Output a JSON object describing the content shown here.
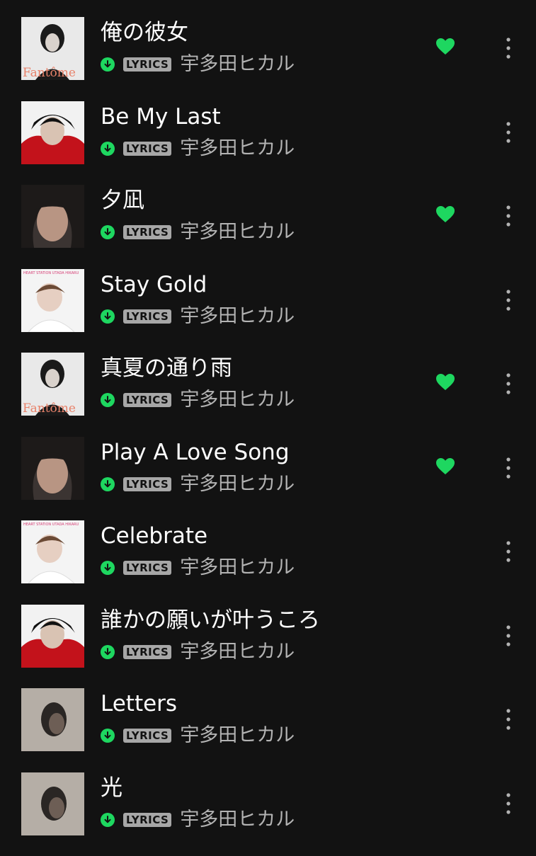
{
  "tracks": [
    {
      "title": "俺の彼女",
      "artist": "宇多田ヒカル",
      "badge": "LYRICS",
      "downloaded": true,
      "liked": true,
      "cover_icon": "album-cover-fantome",
      "cover_text": "Fantôme"
    },
    {
      "title": "Be My Last",
      "artist": "宇多田ヒカル",
      "badge": "LYRICS",
      "downloaded": true,
      "liked": false,
      "cover_icon": "album-cover-red-hood"
    },
    {
      "title": "夕凪",
      "artist": "宇多田ヒカル",
      "badge": "LYRICS",
      "downloaded": true,
      "liked": true,
      "cover_icon": "album-cover-portrait"
    },
    {
      "title": "Stay Gold",
      "artist": "宇多田ヒカル",
      "badge": "LYRICS",
      "downloaded": true,
      "liked": false,
      "cover_icon": "album-cover-heart-station",
      "cover_text": "HEART STATION  UTADA HIKARU"
    },
    {
      "title": "真夏の通り雨",
      "artist": "宇多田ヒカル",
      "badge": "LYRICS",
      "downloaded": true,
      "liked": true,
      "cover_icon": "album-cover-fantome",
      "cover_text": "Fantôme"
    },
    {
      "title": "Play A Love Song",
      "artist": "宇多田ヒカル",
      "badge": "LYRICS",
      "downloaded": true,
      "liked": true,
      "cover_icon": "album-cover-portrait"
    },
    {
      "title": "Celebrate",
      "artist": "宇多田ヒカル",
      "badge": "LYRICS",
      "downloaded": true,
      "liked": false,
      "cover_icon": "album-cover-heart-station",
      "cover_text": "HEART STATION  UTADA HIKARU"
    },
    {
      "title": "誰かの願いが叶うころ",
      "artist": "宇多田ヒカル",
      "badge": "LYRICS",
      "downloaded": true,
      "liked": false,
      "cover_icon": "album-cover-red-hood"
    },
    {
      "title": "Letters",
      "artist": "宇多田ヒカル",
      "badge": "LYRICS",
      "downloaded": true,
      "liked": false,
      "cover_icon": "album-cover-sepia"
    },
    {
      "title": "光",
      "artist": "宇多田ヒカル",
      "badge": "LYRICS",
      "downloaded": true,
      "liked": false,
      "cover_icon": "album-cover-sepia"
    }
  ],
  "colors": {
    "background": "#121212",
    "accent_green": "#1ed760",
    "secondary_text": "#b3b3b3",
    "badge_bg": "#a7a7a7"
  },
  "icons": {
    "download": "download-arrow-icon",
    "like": "heart-icon",
    "more": "more-options-icon"
  }
}
